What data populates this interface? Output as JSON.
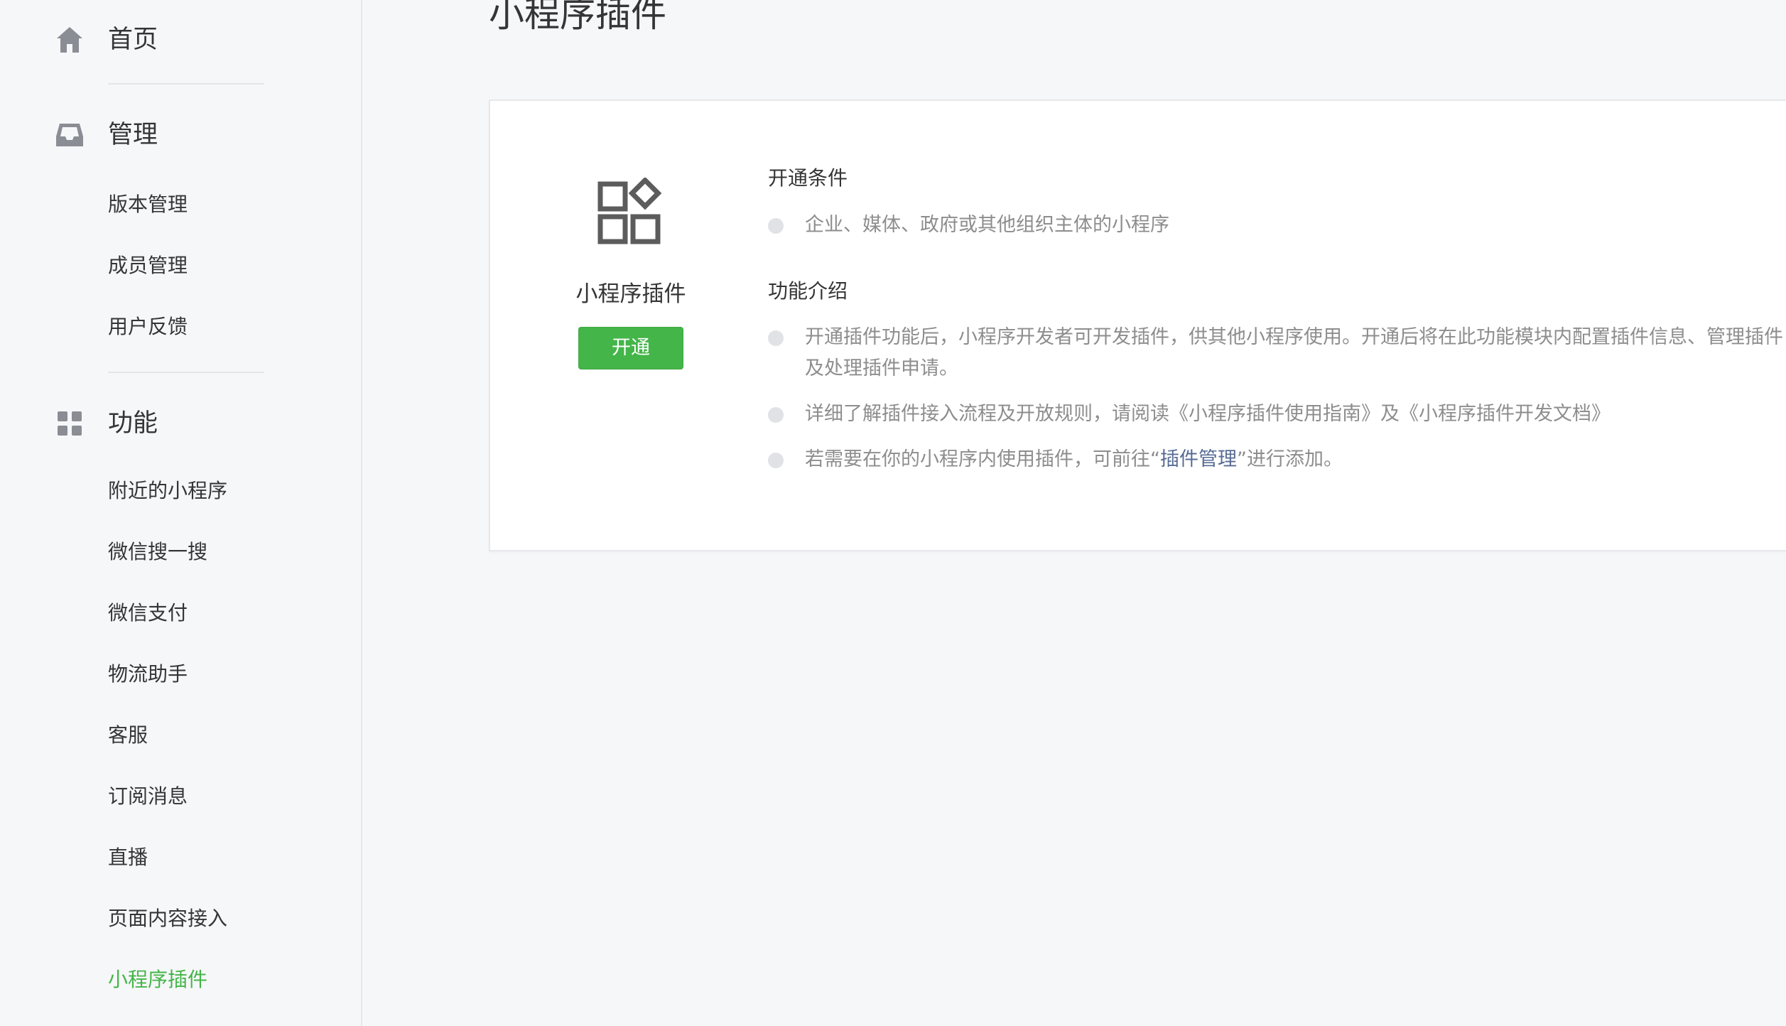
{
  "sidebar": {
    "home": {
      "label": "首页",
      "icon": "home-icon"
    },
    "manage": {
      "label": "管理",
      "icon": "inbox-icon",
      "items": [
        {
          "label": "版本管理"
        },
        {
          "label": "成员管理"
        },
        {
          "label": "用户反馈"
        }
      ]
    },
    "features": {
      "label": "功能",
      "icon": "grid-icon",
      "items": [
        {
          "label": "附近的小程序"
        },
        {
          "label": "微信搜一搜"
        },
        {
          "label": "微信支付"
        },
        {
          "label": "物流助手"
        },
        {
          "label": "客服"
        },
        {
          "label": "订阅消息"
        },
        {
          "label": "直播"
        },
        {
          "label": "页面内容接入"
        },
        {
          "label": "小程序插件",
          "active": true
        }
      ]
    }
  },
  "main": {
    "title": "小程序插件",
    "card": {
      "plugin_name": "小程序插件",
      "plugin_icon": "plugin-icon",
      "open_button": "开通",
      "conditions": {
        "title": "开通条件",
        "items": [
          "企业、媒体、政府或其他组织主体的小程序"
        ]
      },
      "intro": {
        "title": "功能介绍",
        "items": [
          {
            "line1": "开通插件功能后，小程序开发者可开发插件，供其他小程序使用。开通后将在此功能模块内配置插件信息、管理插件",
            "line2": "及处理插件申请。"
          },
          {
            "text": "详细了解插件接入流程及开放规则，请阅读《小程序插件使用指南》及《小程序插件开发文档》"
          },
          {
            "before": "若需要在你的小程序内使用插件，可前往“",
            "link": "插件管理",
            "after": "”进行添加。"
          }
        ]
      }
    }
  },
  "colors": {
    "accent_green": "#44b549",
    "link_blue": "#576b95",
    "background": "#f6f7f9"
  }
}
